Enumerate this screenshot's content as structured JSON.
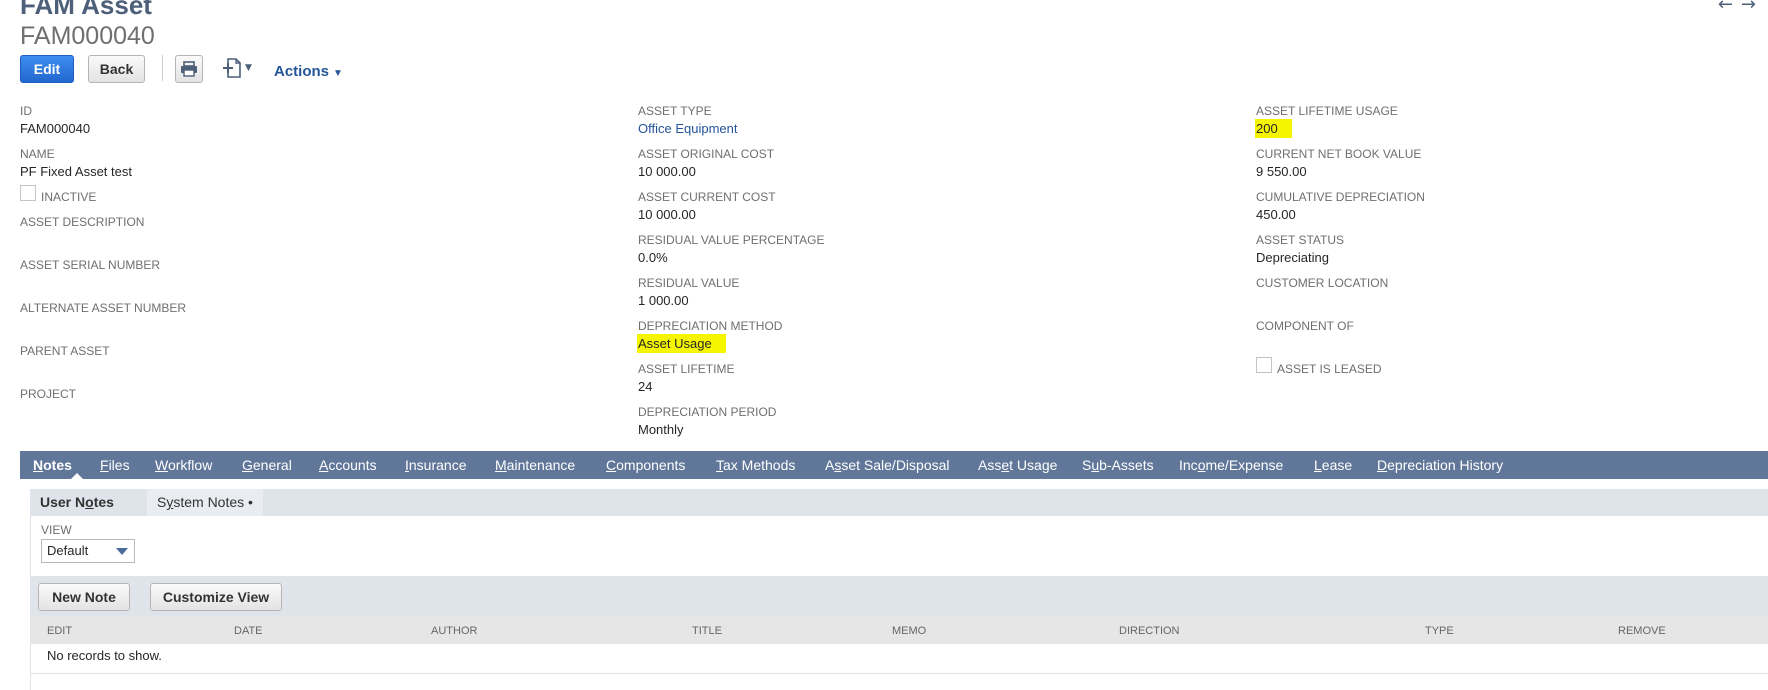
{
  "header": {
    "record_type": "FAM Asset",
    "record_id": "FAM000040"
  },
  "toolbar": {
    "edit_label": "Edit",
    "back_label": "Back",
    "actions_label": "Actions",
    "print_icon": "printer-icon",
    "new_doc_icon": "new-document-icon"
  },
  "fields": {
    "col1": {
      "id_label": "ID",
      "id_value": "FAM000040",
      "name_label": "NAME",
      "name_value": "PF Fixed Asset test",
      "inactive_label": "INACTIVE",
      "description_label": "ASSET DESCRIPTION",
      "serial_label": "ASSET SERIAL NUMBER",
      "alternate_label": "ALTERNATE ASSET NUMBER",
      "parent_label": "PARENT ASSET",
      "project_label": "PROJECT"
    },
    "col2": {
      "type_label": "ASSET TYPE",
      "type_value": "Office Equipment",
      "original_cost_label": "ASSET ORIGINAL COST",
      "original_cost_value": "10 000.00",
      "current_cost_label": "ASSET CURRENT COST",
      "current_cost_value": "10 000.00",
      "residual_pct_label": "RESIDUAL VALUE PERCENTAGE",
      "residual_pct_value": "0.0%",
      "residual_label": "RESIDUAL VALUE",
      "residual_value": "1 000.00",
      "method_label": "DEPRECIATION METHOD",
      "method_value": "Asset Usage",
      "lifetime_label": "ASSET LIFETIME",
      "lifetime_value": "24",
      "period_label": "DEPRECIATION PERIOD",
      "period_value": "Monthly"
    },
    "col3": {
      "lifetime_usage_label": "ASSET LIFETIME USAGE",
      "lifetime_usage_value": "200",
      "nbv_label": "CURRENT NET BOOK VALUE",
      "nbv_value": "9 550.00",
      "cum_dep_label": "CUMULATIVE DEPRECIATION",
      "cum_dep_value": "450.00",
      "status_label": "ASSET STATUS",
      "status_value": "Depreciating",
      "location_label": "CUSTOMER LOCATION",
      "component_label": "COMPONENT OF",
      "leased_label": "ASSET IS LEASED"
    }
  },
  "tabs": [
    {
      "pre": "",
      "u": "N",
      "post": "otes"
    },
    {
      "pre": "",
      "u": "F",
      "post": "iles"
    },
    {
      "pre": "",
      "u": "W",
      "post": "orkflow"
    },
    {
      "pre": "",
      "u": "G",
      "post": "eneral"
    },
    {
      "pre": "",
      "u": "A",
      "post": "ccounts"
    },
    {
      "pre": "",
      "u": "I",
      "post": "nsurance"
    },
    {
      "pre": "",
      "u": "M",
      "post": "aintenance"
    },
    {
      "pre": "",
      "u": "C",
      "post": "omponents"
    },
    {
      "pre": "",
      "u": "T",
      "post": "ax Methods"
    },
    {
      "pre": "A",
      "u": "s",
      "post": "set Sale/Disposal"
    },
    {
      "pre": "Ass",
      "u": "e",
      "post": "t Usage"
    },
    {
      "pre": "S",
      "u": "u",
      "post": "b-Assets"
    },
    {
      "pre": "Inc",
      "u": "o",
      "post": "me/Expense"
    },
    {
      "pre": "",
      "u": "L",
      "post": "ease"
    },
    {
      "pre": "",
      "u": "D",
      "post": "epreciation History"
    }
  ],
  "subtabs": {
    "user_pre": "User N",
    "user_u": "o",
    "user_post": "tes",
    "system_pre": "S",
    "system_u": "y",
    "system_post": "stem Notes •"
  },
  "notes": {
    "view_label": "VIEW",
    "view_selected": "Default",
    "new_note_label": "New Note",
    "customize_label": "Customize View",
    "columns": [
      "EDIT",
      "DATE",
      "AUTHOR",
      "TITLE",
      "MEMO",
      "DIRECTION",
      "TYPE",
      "REMOVE"
    ],
    "empty_text": "No records to show."
  },
  "colors": {
    "tab_bar": "#607799",
    "highlight": "#f5f500",
    "primary_button": "#2c7be5",
    "link": "#255599"
  }
}
